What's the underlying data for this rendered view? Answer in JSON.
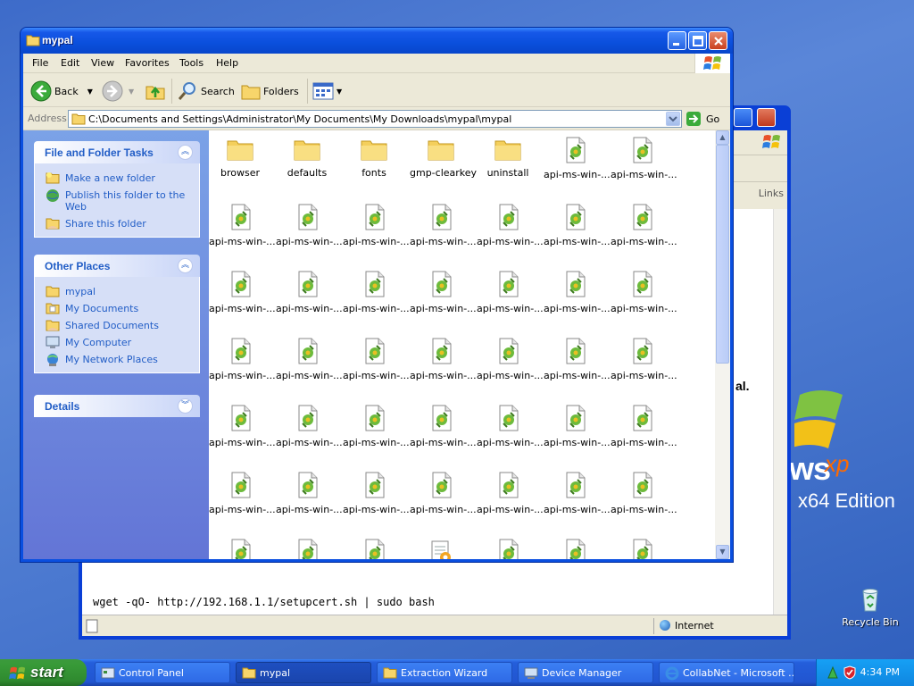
{
  "explorer": {
    "title": "mypal",
    "menu": [
      "File",
      "Edit",
      "View",
      "Favorites",
      "Tools",
      "Help"
    ],
    "toolbar": {
      "back": "Back",
      "search": "Search",
      "folders": "Folders"
    },
    "address_label": "Address",
    "address": "C:\\Documents and Settings\\Administrator\\My Documents\\My Downloads\\mypal\\mypal",
    "go": "Go",
    "tasks": {
      "title": "File and Folder Tasks",
      "items": [
        "Make a new folder",
        "Publish this folder to the Web",
        "Share this folder"
      ]
    },
    "places": {
      "title": "Other Places",
      "items": [
        "mypal",
        "My Documents",
        "Shared Documents",
        "My Computer",
        "My Network Places"
      ]
    },
    "details": {
      "title": "Details"
    },
    "folders": [
      "browser",
      "defaults",
      "fonts",
      "gmp-clearkey",
      "uninstall"
    ],
    "file_label": "api-ms-win-..."
  },
  "ie": {
    "links": "Links",
    "text_fragment": "al.",
    "cmd_line": "wget -qO- http://192.168.1.1/setupcert.sh | sudo bash",
    "zone": "Internet"
  },
  "desktop": {
    "logo_main": "ws",
    "logo_xp": "xp",
    "logo_edition": "x64 Edition",
    "recycle_bin": "Recycle Bin"
  },
  "taskbar": {
    "start": "start",
    "items": [
      {
        "label": "Control Panel",
        "icon": "control-panel-icon",
        "active": false
      },
      {
        "label": "mypal",
        "icon": "folder-icon",
        "active": true
      },
      {
        "label": "Extraction Wizard",
        "icon": "folder-icon",
        "active": false
      },
      {
        "label": "Device Manager",
        "icon": "device-manager-icon",
        "active": false
      },
      {
        "label": "CollabNet - Microsoft ...",
        "icon": "ie-icon",
        "active": false
      }
    ],
    "clock": "4:34 PM"
  },
  "colors": {
    "accent": "#0a4fe0",
    "link": "#215dc6",
    "start_green": "#389a38"
  }
}
